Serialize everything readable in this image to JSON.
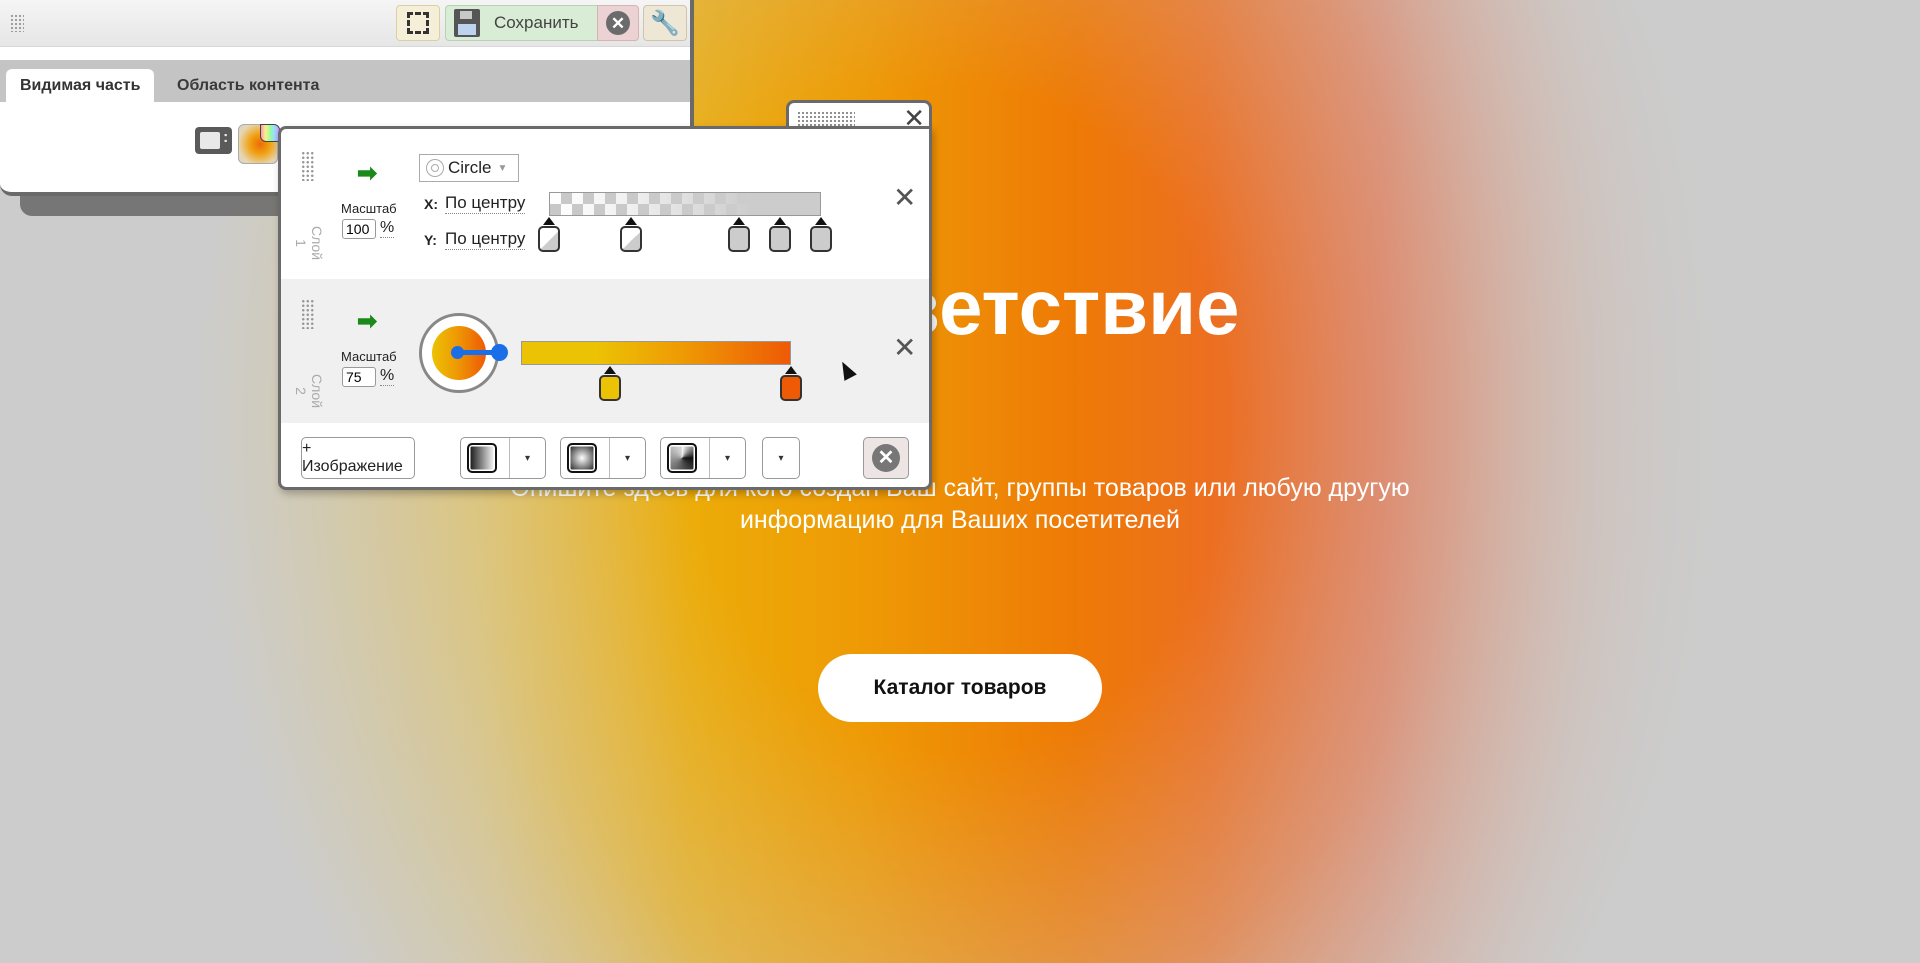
{
  "page": {
    "hero_title": "Приветствие",
    "hero_subtitle": "Опишите здесь для кого создан Ваш сайт, группы товаров или любую другую информацию для Ваших посетителей",
    "hero_button": "Каталог товаров",
    "background_colors": [
      "#ecc204",
      "#ee9a04",
      "#ee6a06",
      "#cccccc"
    ]
  },
  "editor_panel": {
    "toolbar": {
      "select_area_icon": "select-area-icon",
      "save_label": "Сохранить",
      "save_icon": "floppy-disk-icon",
      "cancel_icon": "close-circle-icon",
      "settings_icon": "wrench-icon"
    },
    "tabs": [
      {
        "label": "Видимая часть",
        "active": true
      },
      {
        "label": "Область контента",
        "active": false
      }
    ],
    "icons": [
      "list-settings-icon",
      "background-gradient-icon"
    ]
  },
  "gradient_dialog": {
    "close_label": "✕",
    "layers": [
      {
        "name": "Слой 1",
        "scale_label": "Масштаб",
        "scale_value": "100",
        "scale_unit": "%",
        "shape": "Circle",
        "x_label": "X:",
        "x_value": "По центру",
        "y_label": "Y:",
        "y_value": "По центру",
        "type": "transparency",
        "stops": [
          {
            "position": 0,
            "color": "#ffffff",
            "opacity": 0.0
          },
          {
            "position": 0.3,
            "color": "#ffffff",
            "opacity": 0.3
          },
          {
            "position": 0.7,
            "color": "#cccccc",
            "opacity": 0.85
          },
          {
            "position": 0.85,
            "color": "#cccccc",
            "opacity": 1.0
          },
          {
            "position": 1.0,
            "color": "#cccccc",
            "opacity": 1.0
          }
        ],
        "remove_label": "✕"
      },
      {
        "name": "Слой 2",
        "scale_label": "Масштаб",
        "scale_value": "75",
        "scale_unit": "%",
        "type": "linear",
        "angle_deg": 90,
        "stops": [
          {
            "position": 0.33,
            "color": "#ecc204"
          },
          {
            "position": 1.0,
            "color": "#ee5a06"
          }
        ],
        "remove_label": "✕"
      }
    ],
    "footer": {
      "add_image_label": "+ Изображение",
      "gradient_buttons": [
        "linear-gradient-icon",
        "radial-gradient-icon",
        "conic-gradient-icon"
      ],
      "dropdown_glyph": "▾",
      "delete_all_icon": "close-circle-icon"
    }
  }
}
